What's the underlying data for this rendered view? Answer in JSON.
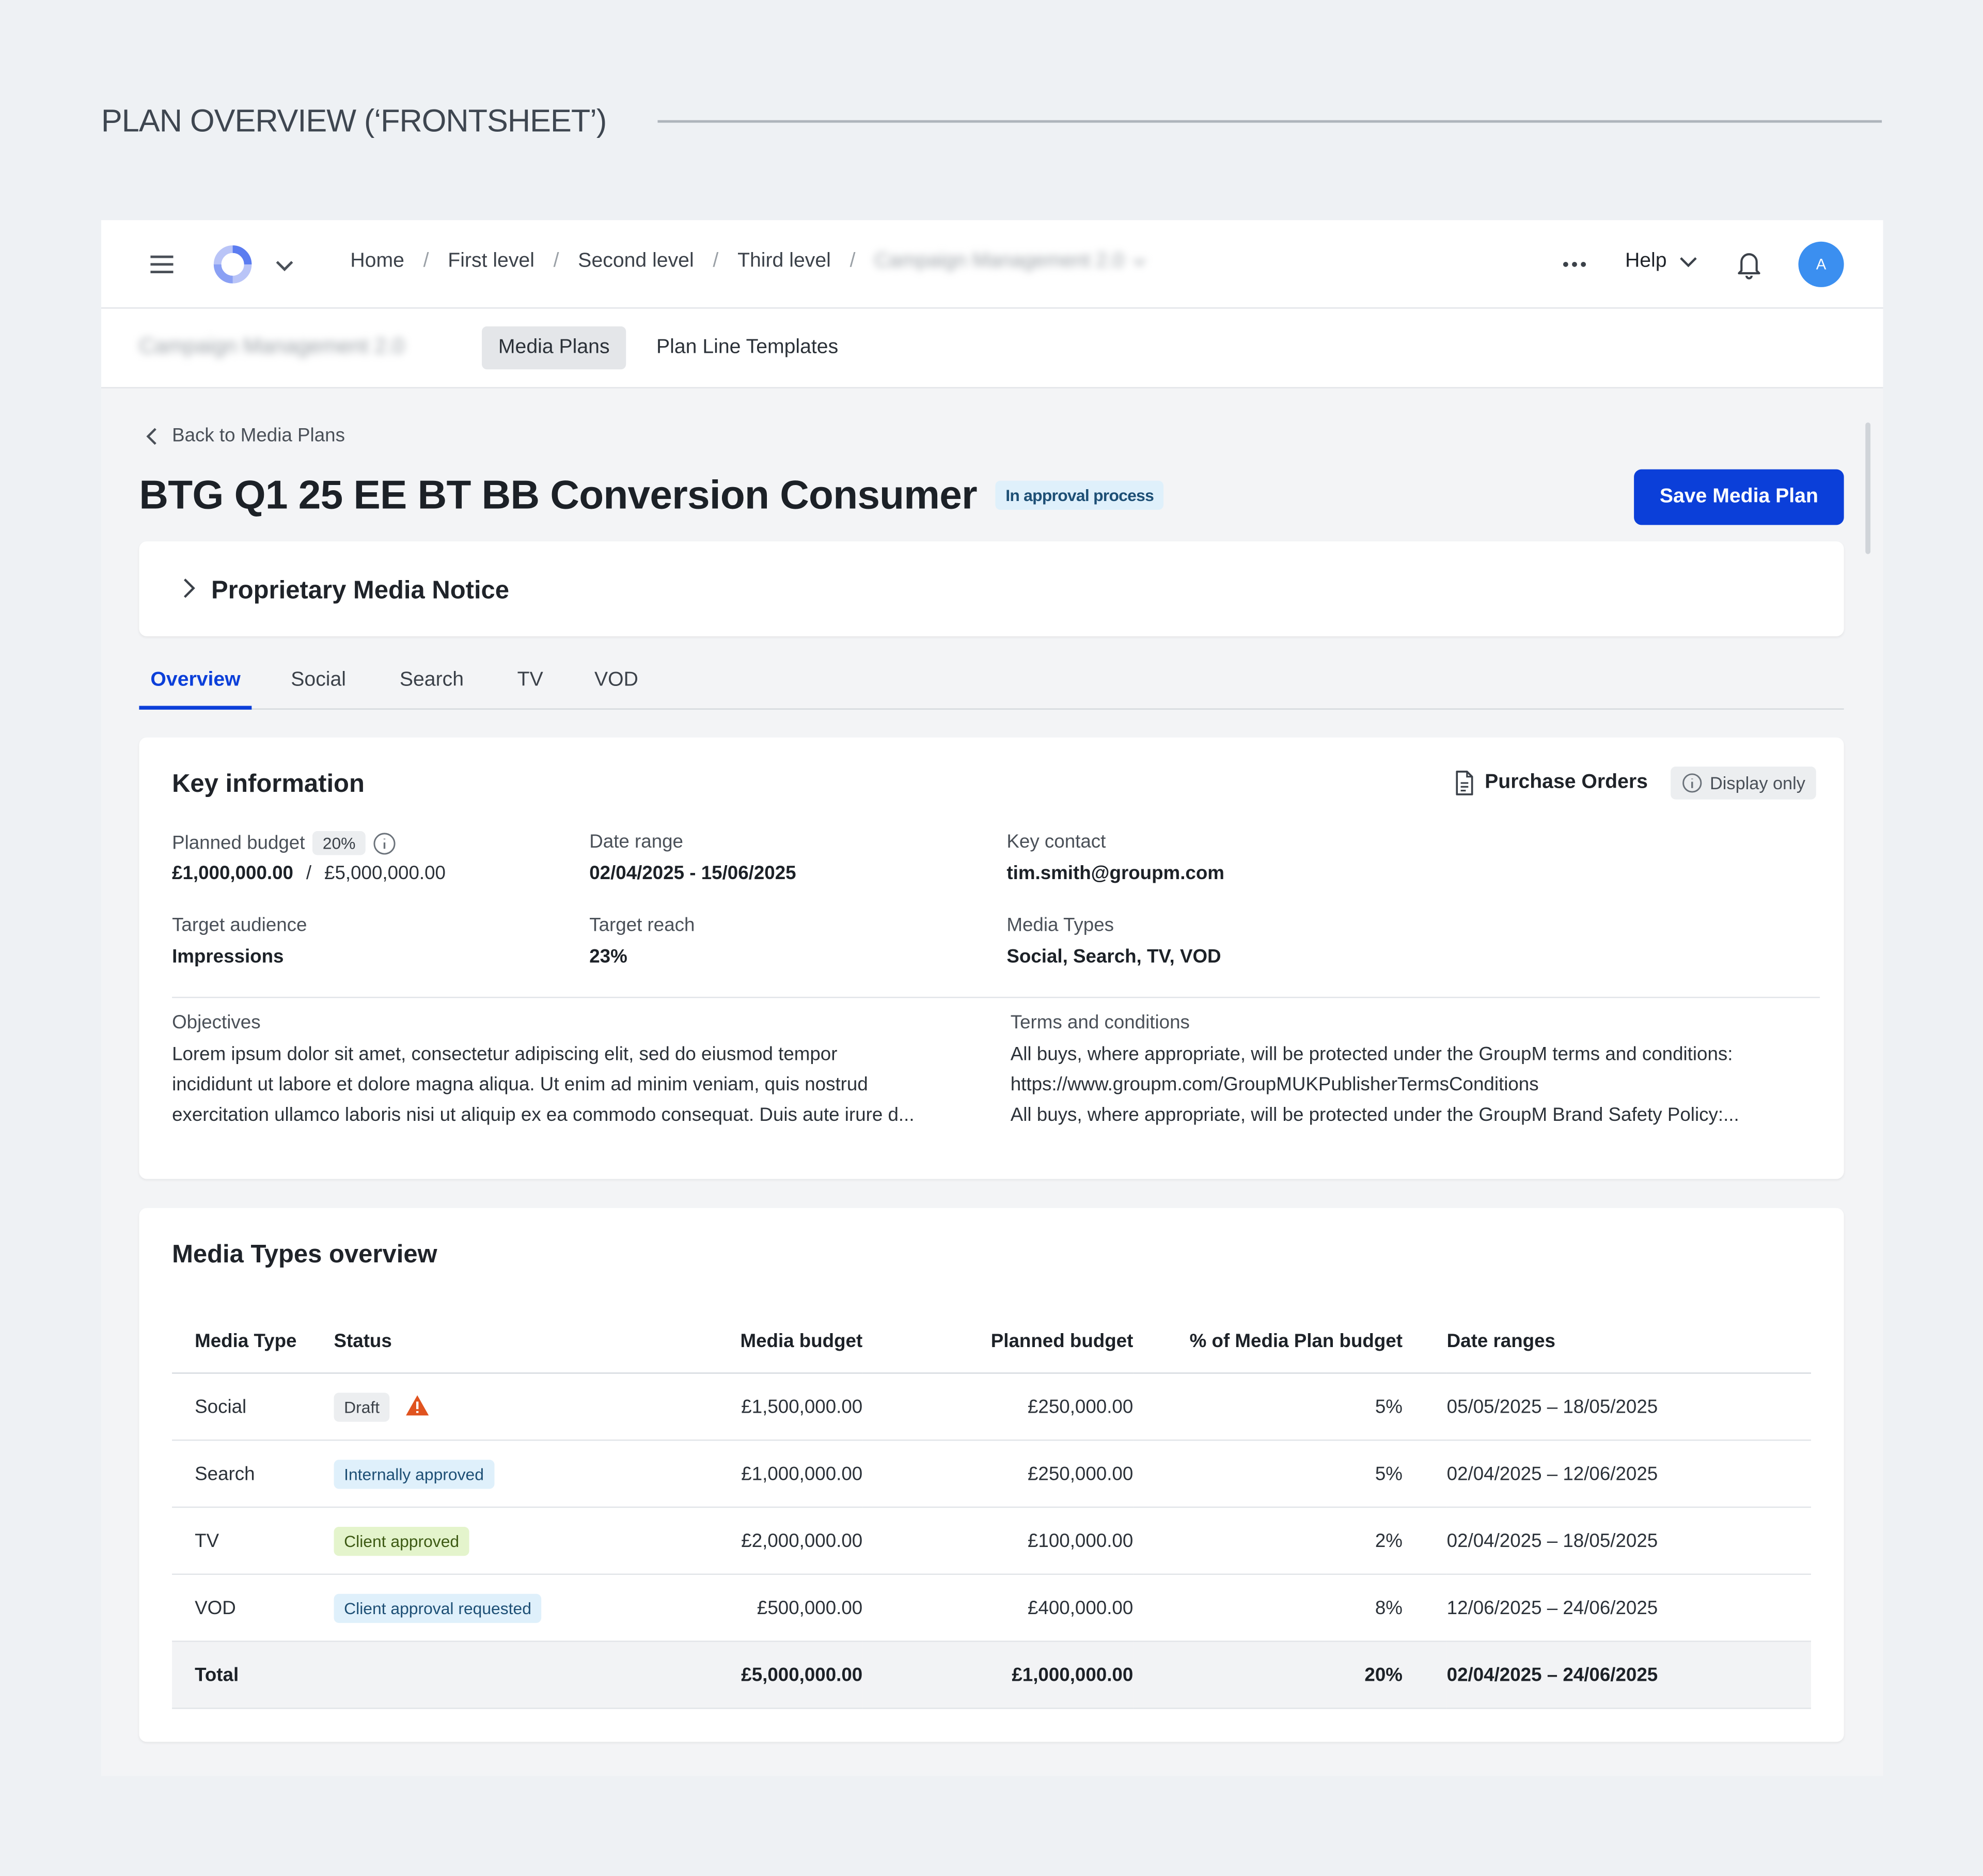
{
  "section_heading": "PLAN OVERVIEW (‘FRONTSHEET’)",
  "topbar": {
    "breadcrumb": [
      "Home",
      "First level",
      "Second level",
      "Third level"
    ],
    "breadcrumb_current": "Campaign Management 2.0",
    "help_label": "Help",
    "avatar_initial": "A"
  },
  "subbar": {
    "app_name": "Campaign Management 2.0",
    "tabs": [
      "Media Plans",
      "Plan Line Templates"
    ]
  },
  "page": {
    "back_label": "Back to Media Plans",
    "title": "BTG Q1 25 EE BT BB Conversion Consumer",
    "status_badge": "In approval process",
    "save_label": "Save Media Plan",
    "notice_title": "Proprietary Media Notice",
    "tabs": [
      "Overview",
      "Social",
      "Search",
      "TV",
      "VOD"
    ]
  },
  "key_info": {
    "title": "Key information",
    "purchase_orders_label": "Purchase Orders",
    "display_only_label": "Display only",
    "planned_budget_label": "Planned budget",
    "planned_budget_pct": "20%",
    "planned_budget_value": "£1,000,000.00",
    "planned_budget_separator": "/",
    "planned_budget_total": "£5,000,000.00",
    "date_range_label": "Date range",
    "date_range_value": "02/04/2025 - 15/06/2025",
    "key_contact_label": "Key contact",
    "key_contact_value": "tim.smith@groupm.com",
    "target_audience_label": "Target audience",
    "target_audience_value": "Impressions",
    "target_reach_label": "Target reach",
    "target_reach_value": "23%",
    "media_types_label": "Media Types",
    "media_types_value": "Social, Search, TV, VOD",
    "objectives_label": "Objectives",
    "objectives_lines": [
      "Lorem ipsum dolor sit amet, consectetur adipiscing elit, sed do eiusmod tempor",
      "incididunt ut labore et dolore magna aliqua. Ut enim ad minim veniam, quis nostrud",
      "exercitation ullamco laboris nisi ut aliquip ex ea commodo consequat. Duis aute irure d..."
    ],
    "terms_label": "Terms and conditions",
    "terms_lines": [
      "All buys, where appropriate, will be protected under the GroupM terms and conditions:",
      "https://www.groupm.com/GroupMUKPublisherTermsConditions",
      "All buys, where appropriate, will be protected under the GroupM Brand Safety Policy:..."
    ]
  },
  "media_types_overview": {
    "title": "Media Types overview",
    "columns": [
      "Media Type",
      "Status",
      "Media budget",
      "Planned budget",
      "% of Media Plan budget",
      "Date ranges"
    ],
    "rows": [
      {
        "type": "Social",
        "status": "Draft",
        "status_style": "gray",
        "media_budget": "£1,500,000.00",
        "planned_budget": "£250,000.00",
        "pct": "5%",
        "dates": "05/05/2025 – 18/05/2025"
      },
      {
        "type": "Search",
        "status": "Internally approved",
        "status_style": "blue",
        "media_budget": "£1,000,000.00",
        "planned_budget": "£250,000.00",
        "pct": "5%",
        "dates": "02/04/2025 – 12/06/2025"
      },
      {
        "type": "TV",
        "status": "Client approved",
        "status_style": "green",
        "media_budget": "£2,000,000.00",
        "planned_budget": "£100,000.00",
        "pct": "2%",
        "dates": "02/04/2025 – 18/05/2025"
      },
      {
        "type": "VOD",
        "status": "Client approval requested",
        "status_style": "blue",
        "media_budget": "£500,000.00",
        "planned_budget": "£400,000.00",
        "pct": "8%",
        "dates": "12/06/2025 – 24/06/2025"
      }
    ],
    "total": {
      "label": "Total",
      "media_budget": "£5,000,000.00",
      "planned_budget": "£1,000,000.00",
      "pct": "20%",
      "dates": "02/04/2025 – 24/06/2025"
    }
  },
  "colors": {
    "primary": "#0b3fd9",
    "avatar": "#3b8ff0",
    "warning": "#e0531f"
  },
  "icons": [
    "menu-icon",
    "app-logo-icon",
    "chevron-down-icon",
    "more-icon",
    "bell-icon",
    "chevron-left-icon",
    "chevron-right-icon",
    "info-icon",
    "document-icon",
    "warning-icon"
  ]
}
